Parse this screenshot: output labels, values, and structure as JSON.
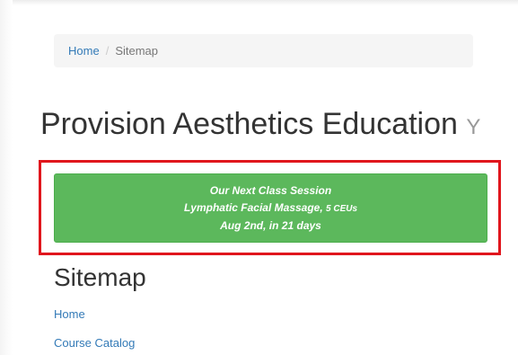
{
  "breadcrumb": {
    "home": "Home",
    "separator": "/",
    "current": "Sitemap"
  },
  "page": {
    "title": "Provision Aesthetics Education",
    "title_suffix": "Y"
  },
  "next_class": {
    "heading": "Our Next Class Session",
    "course": "Lymphatic Facial Massage,",
    "ceus": "5 CEUs",
    "date": "Aug 2nd, in 21 days"
  },
  "sitemap": {
    "title": "Sitemap",
    "links": [
      "Home",
      "Course Catalog"
    ]
  },
  "colors": {
    "link": "#337ab7",
    "success": "#5cb85c",
    "highlight_frame": "#e0161d"
  }
}
